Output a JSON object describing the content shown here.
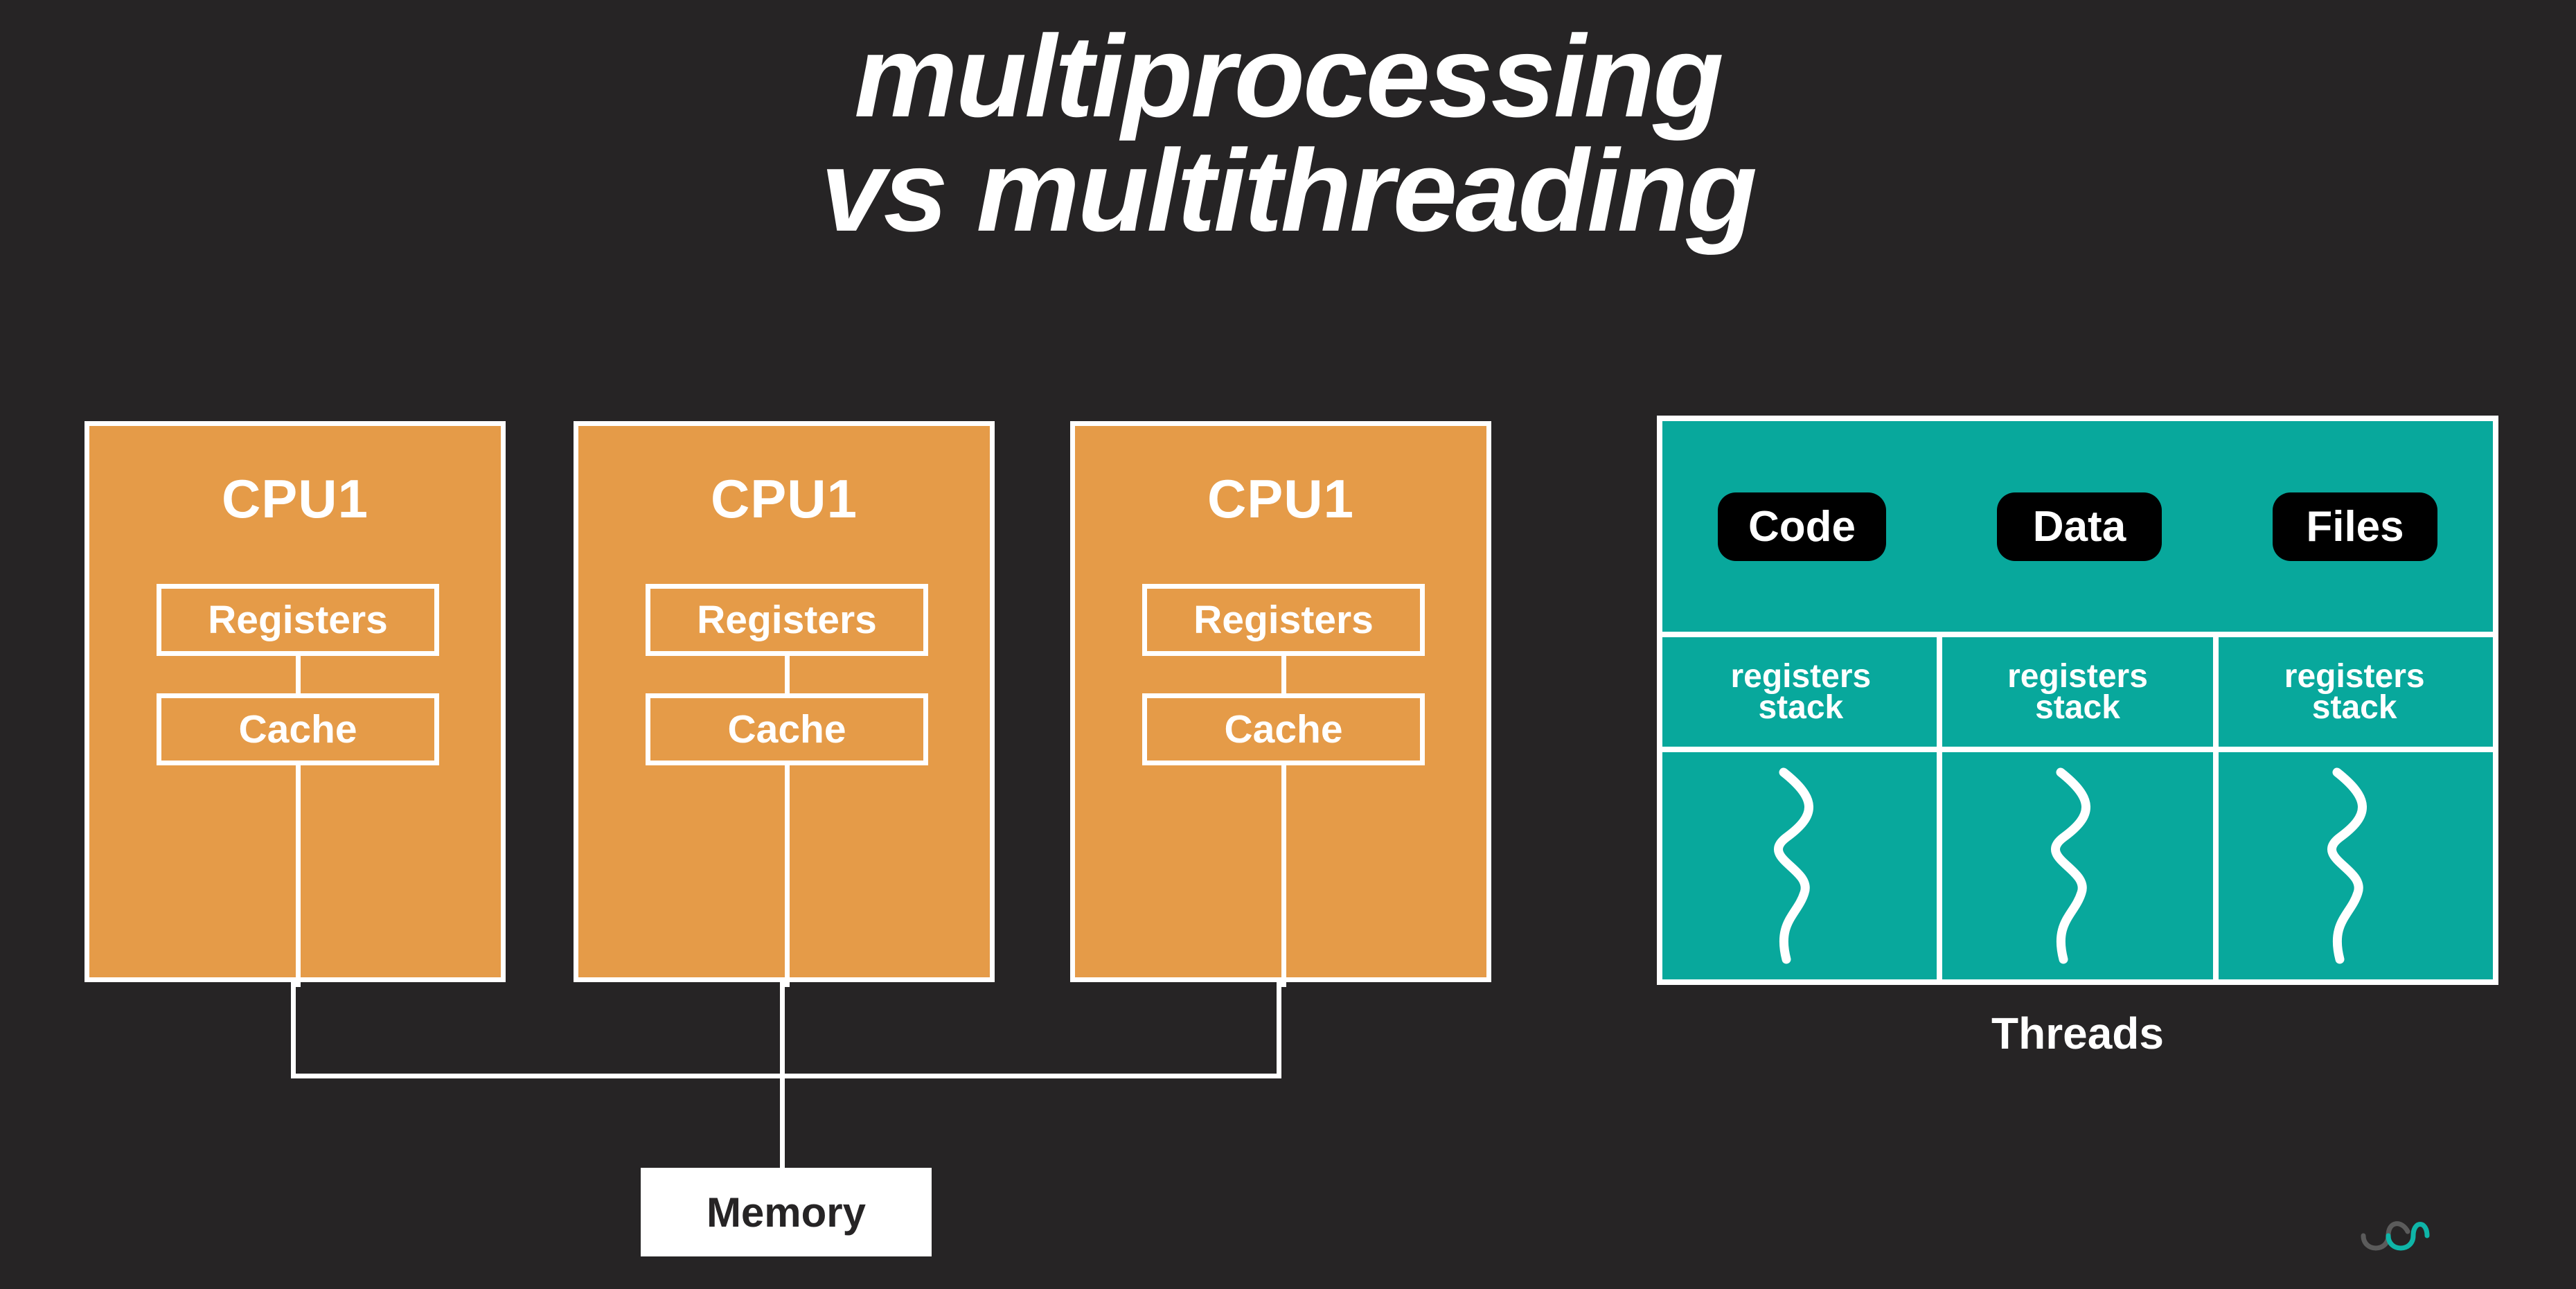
{
  "background_color": "#262425",
  "accent_orange": "#E59B48",
  "accent_teal": "#08A89C",
  "title": {
    "line1": "multiprocessing",
    "line2": "vs multithreading"
  },
  "multiprocessing": {
    "cpus": [
      {
        "name": "CPU1",
        "registers_label": "Registers",
        "cache_label": "Cache"
      },
      {
        "name": "CPU1",
        "registers_label": "Registers",
        "cache_label": "Cache"
      },
      {
        "name": "CPU1",
        "registers_label": "Registers",
        "cache_label": "Cache"
      }
    ],
    "memory_label": "Memory"
  },
  "multithreading": {
    "shared_blocks": [
      {
        "label": "Code"
      },
      {
        "label": "Data"
      },
      {
        "label": "Files"
      }
    ],
    "thread_columns": [
      {
        "registers_label": "registers",
        "stack_label": "stack",
        "squiggle": "thread-squiggle"
      },
      {
        "registers_label": "registers",
        "stack_label": "stack",
        "squiggle": "thread-squiggle"
      },
      {
        "registers_label": "registers",
        "stack_label": "stack",
        "squiggle": "thread-squiggle"
      }
    ],
    "caption": "Threads"
  },
  "logo": {
    "name": "brand-logo",
    "gray_color": "#5b5b5b",
    "teal_color": "#0FB5A8"
  }
}
